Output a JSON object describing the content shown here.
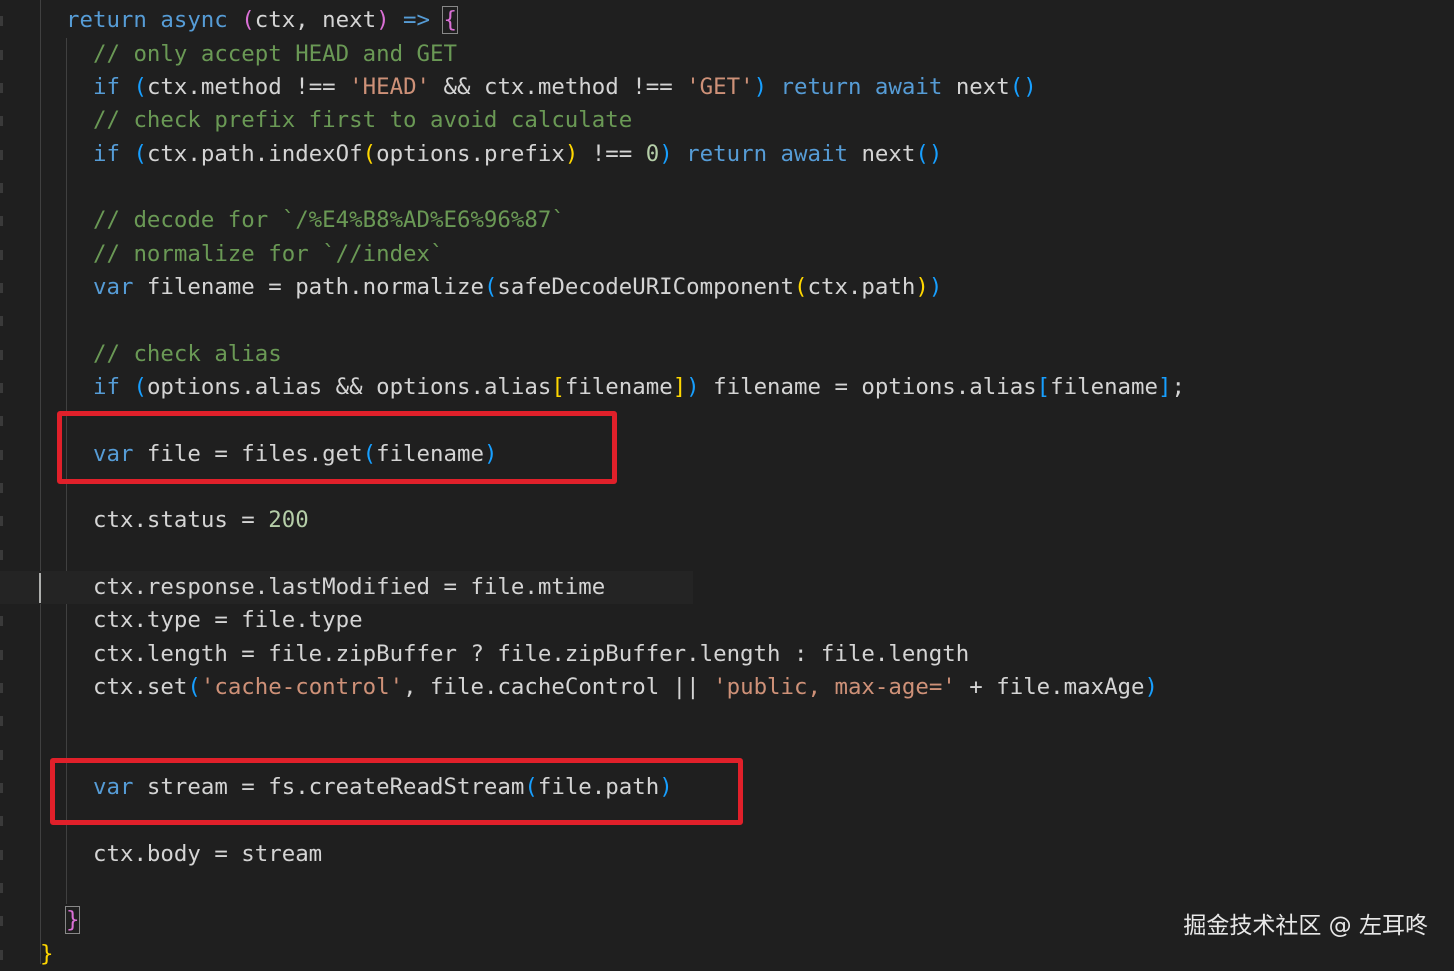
{
  "editor": {
    "lines": [
      [
        {
          "t": "return async ",
          "c": "kw"
        },
        {
          "t": "(",
          "c": "b2"
        },
        {
          "t": "ctx, next",
          "c": "var"
        },
        {
          "t": ")",
          "c": "b2"
        },
        {
          "t": " => ",
          "c": "kw"
        },
        {
          "t": "{",
          "c": "b2 brace-hl"
        }
      ],
      [
        {
          "t": "// only accept HEAD and GET",
          "c": "com"
        }
      ],
      [
        {
          "t": "if ",
          "c": "kw"
        },
        {
          "t": "(",
          "c": "b3"
        },
        {
          "t": "ctx.method !== ",
          "c": "var"
        },
        {
          "t": "'HEAD'",
          "c": "str"
        },
        {
          "t": " && ctx.method !== ",
          "c": "var"
        },
        {
          "t": "'GET'",
          "c": "str"
        },
        {
          "t": ")",
          "c": "b3"
        },
        {
          "t": " return await ",
          "c": "kw"
        },
        {
          "t": "next",
          "c": "var"
        },
        {
          "t": "()",
          "c": "b3"
        }
      ],
      [
        {
          "t": "// check prefix first to avoid calculate",
          "c": "com"
        }
      ],
      [
        {
          "t": "if ",
          "c": "kw"
        },
        {
          "t": "(",
          "c": "b3"
        },
        {
          "t": "ctx.path.indexOf",
          "c": "var"
        },
        {
          "t": "(",
          "c": "b1"
        },
        {
          "t": "options.prefix",
          "c": "var"
        },
        {
          "t": ")",
          "c": "b1"
        },
        {
          "t": " !== ",
          "c": "var"
        },
        {
          "t": "0",
          "c": "num"
        },
        {
          "t": ")",
          "c": "b3"
        },
        {
          "t": " return await ",
          "c": "kw"
        },
        {
          "t": "next",
          "c": "var"
        },
        {
          "t": "()",
          "c": "b3"
        }
      ],
      [],
      [
        {
          "t": "// decode for `/%E4%B8%AD%E6%96%87`",
          "c": "com"
        }
      ],
      [
        {
          "t": "// normalize for `//index`",
          "c": "com"
        }
      ],
      [
        {
          "t": "var ",
          "c": "kw"
        },
        {
          "t": "filename = path.normalize",
          "c": "var"
        },
        {
          "t": "(",
          "c": "b3"
        },
        {
          "t": "safeDecodeURIComponent",
          "c": "var"
        },
        {
          "t": "(",
          "c": "b1"
        },
        {
          "t": "ctx.path",
          "c": "var"
        },
        {
          "t": ")",
          "c": "b1"
        },
        {
          "t": ")",
          "c": "b3"
        }
      ],
      [],
      [
        {
          "t": "// check alias",
          "c": "com"
        }
      ],
      [
        {
          "t": "if ",
          "c": "kw"
        },
        {
          "t": "(",
          "c": "b3"
        },
        {
          "t": "options.alias && options.alias",
          "c": "var"
        },
        {
          "t": "[",
          "c": "b1"
        },
        {
          "t": "filename",
          "c": "var"
        },
        {
          "t": "]",
          "c": "b1"
        },
        {
          "t": ")",
          "c": "b3"
        },
        {
          "t": " filename = options.alias",
          "c": "var"
        },
        {
          "t": "[",
          "c": "b3"
        },
        {
          "t": "filename",
          "c": "var"
        },
        {
          "t": "]",
          "c": "b3"
        },
        {
          "t": ";",
          "c": "var"
        }
      ],
      [],
      [
        {
          "t": "var ",
          "c": "kw"
        },
        {
          "t": "file = files.get",
          "c": "var"
        },
        {
          "t": "(",
          "c": "b3"
        },
        {
          "t": "filename",
          "c": "var"
        },
        {
          "t": ")",
          "c": "b3"
        }
      ],
      [],
      [
        {
          "t": "ctx.status = ",
          "c": "var"
        },
        {
          "t": "200",
          "c": "num"
        }
      ],
      [],
      [
        {
          "t": "ctx.response.lastModified = file.mtime",
          "c": "var"
        }
      ],
      [
        {
          "t": "ctx.type = file.type",
          "c": "var"
        }
      ],
      [
        {
          "t": "ctx.length = file.zipBuffer ? file.zipBuffer.length : file.length",
          "c": "var"
        }
      ],
      [
        {
          "t": "ctx.set",
          "c": "var"
        },
        {
          "t": "(",
          "c": "b3"
        },
        {
          "t": "'cache-control'",
          "c": "str"
        },
        {
          "t": ", file.cacheControl || ",
          "c": "var"
        },
        {
          "t": "'public, max-age='",
          "c": "str"
        },
        {
          "t": " + file.maxAge",
          "c": "var"
        },
        {
          "t": ")",
          "c": "b3"
        }
      ],
      [],
      [],
      [
        {
          "t": "var ",
          "c": "kw"
        },
        {
          "t": "stream = fs.createReadStream",
          "c": "var"
        },
        {
          "t": "(",
          "c": "b3"
        },
        {
          "t": "file.path",
          "c": "var"
        },
        {
          "t": ")",
          "c": "b3"
        }
      ],
      [],
      [
        {
          "t": "ctx.body = stream",
          "c": "var"
        }
      ],
      [],
      [
        {
          "t": "}",
          "c": "b2 brace-hl"
        }
      ],
      [
        {
          "t": "}",
          "c": "b1"
        }
      ]
    ]
  },
  "colors": {
    "background": "#1f1f1f",
    "annotation": "#e0202a"
  },
  "watermark": "掘金技术社区 @ 左耳咚"
}
